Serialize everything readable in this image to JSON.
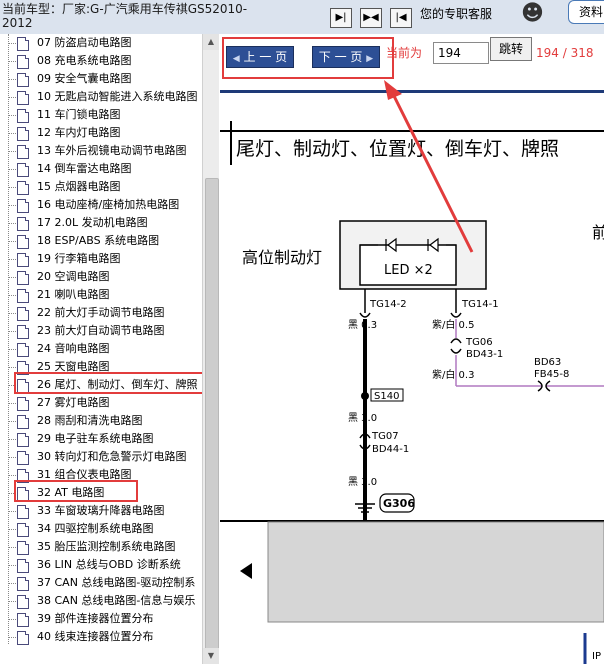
{
  "header": {
    "car_title_label": "当前车型：",
    "car_title_value": "厂家:G-广汽乘用车传祺GS52010-2012",
    "service_text": "您的专职客服",
    "material_label": "资料",
    "nav_buttons": [
      "first",
      "prev-next",
      "last"
    ]
  },
  "tree": {
    "items": [
      {
        "label": "07 防盗启动电路图"
      },
      {
        "label": "08 充电系统电路图"
      },
      {
        "label": "09 安全气囊电路图"
      },
      {
        "label": "10 无匙启动智能进入系统电路图"
      },
      {
        "label": "11 车门锁电路图"
      },
      {
        "label": "12 车内灯电路图"
      },
      {
        "label": "13 车外后视镜电动调节电路图"
      },
      {
        "label": "14 倒车雷达电路图"
      },
      {
        "label": "15 点烟器电路图"
      },
      {
        "label": "16 电动座椅/座椅加热电路图"
      },
      {
        "label": "17 2.0L 发动机电路图"
      },
      {
        "label": "18 ESP/ABS 系统电路图"
      },
      {
        "label": "19 行李箱电路图"
      },
      {
        "label": "20 空调电路图"
      },
      {
        "label": "21 喇叭电路图"
      },
      {
        "label": "22 前大灯手动调节电路图"
      },
      {
        "label": "23 前大灯自动调节电路图"
      },
      {
        "label": "24 音响电路图"
      },
      {
        "label": "25 天窗电路图"
      },
      {
        "label": "26 尾灯、制动灯、倒车灯、牌照"
      },
      {
        "label": "27 雾灯电路图"
      },
      {
        "label": "28 雨刮和清洗电路图"
      },
      {
        "label": "29 电子驻车系统电路图"
      },
      {
        "label": "30 转向灯和危急警示灯电路图"
      },
      {
        "label": "31 组合仪表电路图"
      },
      {
        "label": "32 AT 电路图"
      },
      {
        "label": "33 车窗玻璃升降器电路图"
      },
      {
        "label": "34 四驱控制系统电路图"
      },
      {
        "label": "35 胎压监测控制系统电路图"
      },
      {
        "label": "36 LIN 总线与OBD 诊断系统"
      },
      {
        "label": "37 CAN 总线电路图-驱动控制系"
      },
      {
        "label": "38 CAN 总线电路图-信息与娱乐"
      },
      {
        "label": "39 部件连接器位置分布"
      },
      {
        "label": "40 线束连接器位置分布"
      }
    ]
  },
  "toolbar": {
    "prev_label": "上 一 页",
    "next_label": "下 一 页",
    "current_label": "当前为",
    "page_value": "194",
    "jump_label": "跳转",
    "total_label": "194 / 318"
  },
  "diagram": {
    "title": "尾灯、制动灯、位置灯、倒车灯、牌照",
    "side_label": "前",
    "component_label": "高位制动灯",
    "led_label": "LED ×2",
    "pins": {
      "left": "TG14-2",
      "right": "TG14-1"
    },
    "wires": {
      "w1": "黑  0.3",
      "w2": "紫/白  0.5",
      "w3": "紫/白  0.3",
      "w4": "黑  3.0",
      "w5": "黑  3.0"
    },
    "connectors": {
      "tg06": "TG06",
      "bd43": "BD43-1",
      "bd63": "BD63",
      "fb45": "FB45-8",
      "s140": "S140",
      "tg07": "TG07",
      "bd44": "BD44-1",
      "g306": "G306",
      "ip": "IP"
    }
  },
  "colors": {
    "accent_red": "#e23c3c",
    "toolbar_blue": "#1e3a78",
    "button_blue": "#2d4f95",
    "wire_purple": "#b079c0"
  }
}
